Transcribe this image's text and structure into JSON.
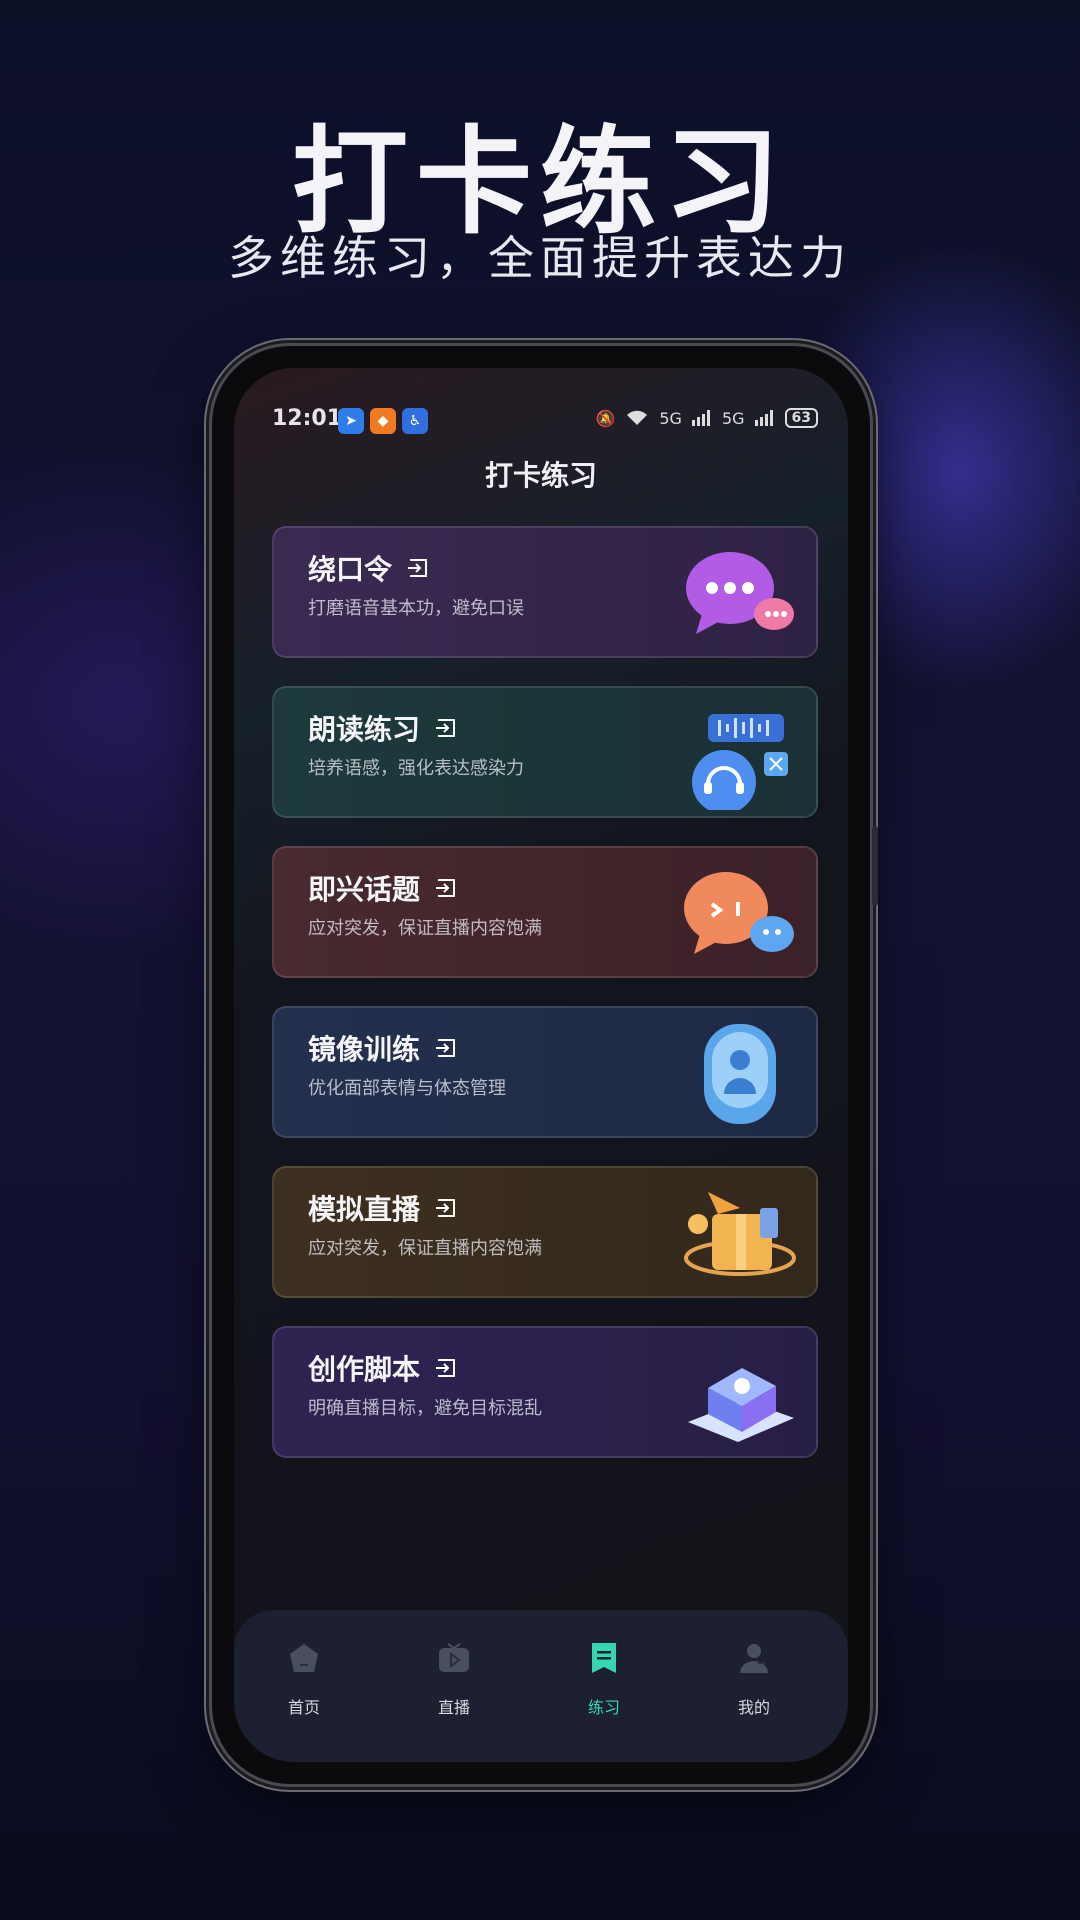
{
  "promo": {
    "title": "打卡练习",
    "subtitle": "多维练习，全面提升表达力"
  },
  "status_bar": {
    "time": "12:01",
    "signal1": "5G",
    "signal2": "5G",
    "battery": "63"
  },
  "screen_title": "打卡练习",
  "cards": [
    {
      "title": "绕口令",
      "desc": "打磨语音基本功，避免口误",
      "color": "#3a2a52"
    },
    {
      "title": "朗读练习",
      "desc": "培养语感，强化表达感染力",
      "color": "#1d3a3c"
    },
    {
      "title": "即兴话题",
      "desc": "应对突发，保证直播内容饱满",
      "color": "#482a30"
    },
    {
      "title": "镜像训练",
      "desc": "优化面部表情与体态管理",
      "color": "#23304e"
    },
    {
      "title": "模拟直播",
      "desc": "应对突发，保证直播内容饱满",
      "color": "#3e3020"
    },
    {
      "title": "创作脚本",
      "desc": "明确直播目标，避免目标混乱",
      "color": "#2f2352"
    }
  ],
  "tabs": [
    {
      "label": "首页",
      "icon": "home-icon"
    },
    {
      "label": "直播",
      "icon": "live-tv-icon"
    },
    {
      "label": "练习",
      "icon": "practice-icon",
      "active": true
    },
    {
      "label": "我的",
      "icon": "profile-icon"
    }
  ],
  "accent_color": "#35d6b2"
}
